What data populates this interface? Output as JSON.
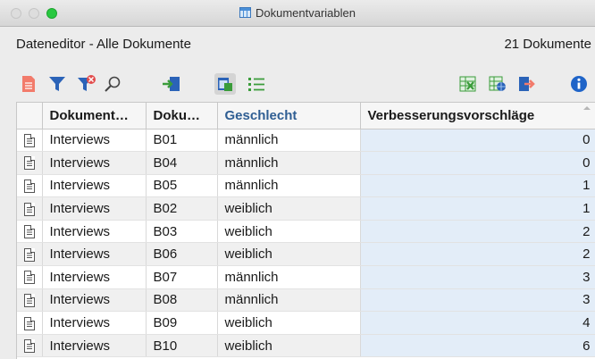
{
  "window": {
    "title": "Dokumentvariablen"
  },
  "header": {
    "title": "Dateneditor - Alle Dokumente",
    "count": "21 Dokumente"
  },
  "toolbar": {
    "colors": {
      "red": "#f27b6b",
      "blue": "#2b63b8",
      "green": "#3a9c3a",
      "info": "#1f64c8"
    }
  },
  "table": {
    "columns": [
      "",
      "Dokument…",
      "Doku…",
      "Geschlecht",
      "Verbesserungsvorschläge"
    ],
    "rows": [
      {
        "group": "Interviews",
        "doc": "B01",
        "gender": "männlich",
        "value": "0"
      },
      {
        "group": "Interviews",
        "doc": "B04",
        "gender": "männlich",
        "value": "0"
      },
      {
        "group": "Interviews",
        "doc": "B05",
        "gender": "männlich",
        "value": "1"
      },
      {
        "group": "Interviews",
        "doc": "B02",
        "gender": "weiblich",
        "value": "1"
      },
      {
        "group": "Interviews",
        "doc": "B03",
        "gender": "weiblich",
        "value": "2"
      },
      {
        "group": "Interviews",
        "doc": "B06",
        "gender": "weiblich",
        "value": "2"
      },
      {
        "group": "Interviews",
        "doc": "B07",
        "gender": "männlich",
        "value": "3"
      },
      {
        "group": "Interviews",
        "doc": "B08",
        "gender": "männlich",
        "value": "3"
      },
      {
        "group": "Interviews",
        "doc": "B09",
        "gender": "weiblich",
        "value": "4"
      },
      {
        "group": "Interviews",
        "doc": "B10",
        "gender": "weiblich",
        "value": "6"
      }
    ]
  }
}
